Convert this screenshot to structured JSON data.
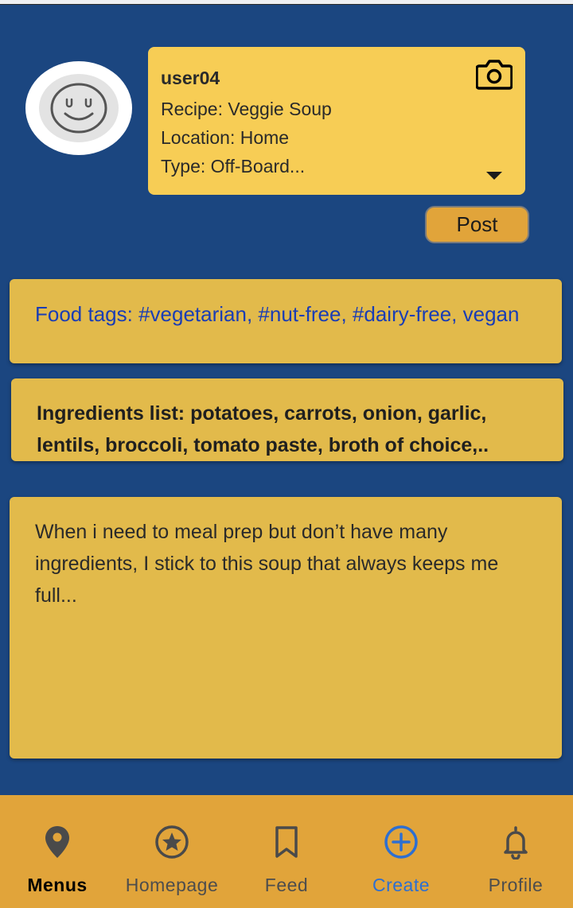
{
  "profile": {
    "username": "user04",
    "recipe": "Recipe: Veggie Soup",
    "location": "Location: Home",
    "type": "Type: Off-Board..."
  },
  "actions": {
    "post_label": "Post"
  },
  "tags": {
    "text": "Food tags: #vegetarian, #nut-free, #dairy-free, vegan"
  },
  "ingredients": {
    "text": "Ingredients list: potatoes, carrots, onion, garlic,\nlentils, broccoli, tomato paste, broth of choice,.."
  },
  "description": {
    "text": "When i need to meal prep but don’t have many ingredients, I stick to this soup that always keeps me full..."
  },
  "nav": {
    "items": [
      {
        "label": "Menus",
        "icon": "location-pin-icon"
      },
      {
        "label": "Homepage",
        "icon": "star-circle-icon"
      },
      {
        "label": "Feed",
        "icon": "bookmark-icon"
      },
      {
        "label": "Create",
        "icon": "add-circle-icon"
      },
      {
        "label": "Profile",
        "icon": "bell-icon"
      }
    ]
  },
  "colors": {
    "background": "#1b4680",
    "info_card": "#f7cd55",
    "cards": "#e2ba4b",
    "nav_bar": "#e1a43a",
    "accent_blue": "#2d6fd1",
    "tag_blue": "#1a3db5"
  }
}
